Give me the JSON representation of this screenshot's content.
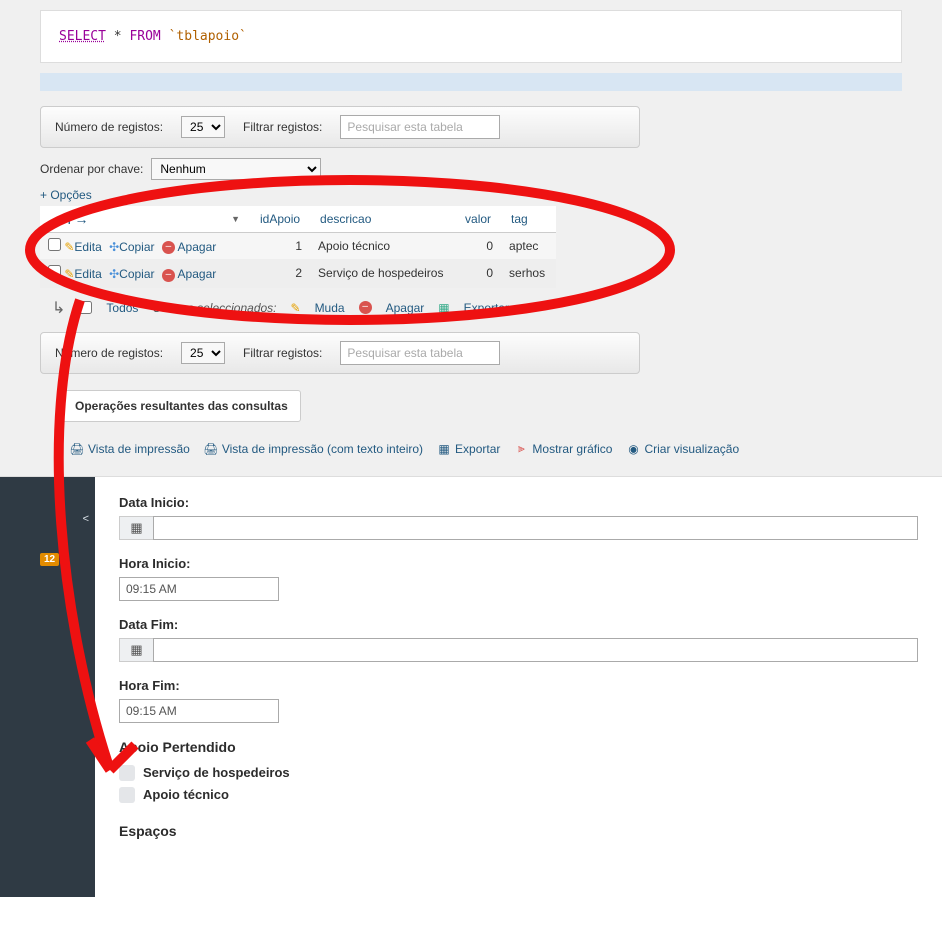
{
  "sql": {
    "select": "SELECT",
    "star": "*",
    "from": "FROM",
    "table": "`tblapoio`"
  },
  "toolbar": {
    "num_registos_label": "Número de registos:",
    "num_registos_value": "25",
    "filtrar_label": "Filtrar registos:",
    "filtrar_placeholder": "Pesquisar esta tabela",
    "filtrar_value": ""
  },
  "sort": {
    "label": "Ordenar por chave:",
    "value": "Nenhum"
  },
  "opcoes": "+ Opções",
  "header_arrows": "←T→",
  "columns": [
    "idApoio",
    "descricao",
    "valor",
    "tag"
  ],
  "rows": [
    {
      "id": "1",
      "descricao": "Apoio técnico",
      "valor": "0",
      "tag": "aptec"
    },
    {
      "id": "2",
      "descricao": "Serviço de hospedeiros",
      "valor": "0",
      "tag": "serhos"
    }
  ],
  "row_actions": {
    "edita": "Edita",
    "copiar": "Copiar",
    "apagar": "Apagar"
  },
  "below": {
    "todos": "Todos",
    "com_os": "Com os seleccionados:",
    "muda": "Muda",
    "apagar": "Apagar",
    "exportar": "Exportar"
  },
  "ops_title": "Operações resultantes das consultas",
  "ops_links": {
    "print": "Vista de impressão",
    "print_full": "Vista de impressão (com texto inteiro)",
    "exportar": "Exportar",
    "mostrar_grafico": "Mostrar gráfico",
    "criar_vis": "Criar visualização"
  },
  "sidebar": {
    "badge": "12"
  },
  "form": {
    "data_inicio": "Data Inicio:",
    "hora_inicio": "Hora Inicio:",
    "hora_inicio_val": "09:15 AM",
    "data_fim": "Data Fim:",
    "hora_fim": "Hora Fim:",
    "hora_fim_val": "09:15 AM",
    "apoio_heading": "Apoio Pertendido",
    "apoio_opts": [
      "Serviço de hospedeiros",
      "Apoio técnico"
    ],
    "espacos": "Espaços"
  }
}
